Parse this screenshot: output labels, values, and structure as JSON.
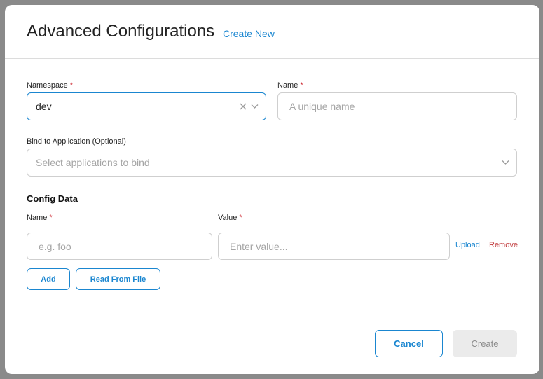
{
  "modal": {
    "title": "Advanced Configurations",
    "create_new_link": "Create New"
  },
  "form": {
    "namespace": {
      "label": "Namespace",
      "required_mark": "*",
      "value": "dev"
    },
    "name": {
      "label": "Name",
      "required_mark": "*",
      "placeholder": "A unique name"
    },
    "bind_application": {
      "label": "Bind to Application (Optional)",
      "placeholder": "Select applications to bind"
    }
  },
  "config_data": {
    "section_title": "Config Data",
    "name_col": {
      "label": "Name",
      "required_mark": "*",
      "placeholder": "e.g. foo"
    },
    "value_col": {
      "label": "Value",
      "required_mark": "*",
      "placeholder": "Enter value..."
    },
    "upload_label": "Upload",
    "remove_label": "Remove",
    "add_label": "Add",
    "read_from_file_label": "Read From File"
  },
  "footer": {
    "cancel_label": "Cancel",
    "create_label": "Create"
  },
  "icons": {
    "clear": "close-icon",
    "dropdown": "chevron-down-icon"
  },
  "colors": {
    "accent": "#1a86d0",
    "danger": "#c0393b",
    "required": "#d0323a",
    "disabled_bg": "#ebebeb",
    "overlay": "#8a8a8a"
  }
}
